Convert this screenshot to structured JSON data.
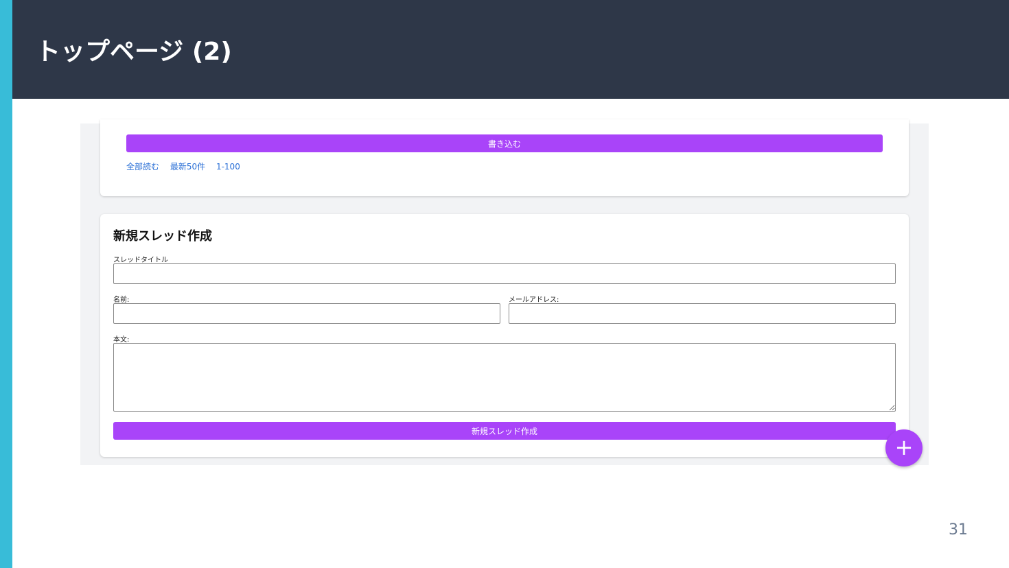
{
  "slide": {
    "title": "トップページ (2)",
    "page_number": "31"
  },
  "thread_card": {
    "write_button_label": "書き込む",
    "links": [
      "全部読む",
      "最新50件",
      "1-100"
    ]
  },
  "new_thread_form": {
    "heading": "新規スレッド作成",
    "title_label": "スレッドタイトル",
    "name_label": "名前:",
    "email_label": "メールアドレス:",
    "body_label": "本文:",
    "title_value": "",
    "name_value": "",
    "email_value": "",
    "body_value": "",
    "submit_label": "新規スレッド作成"
  },
  "fab": {
    "icon": "plus-icon",
    "symbol": "+"
  },
  "colors": {
    "header_bg": "#2e3748",
    "accent_bar": "#38bcd8",
    "button": "#a944f9",
    "link": "#2a6fd6"
  }
}
